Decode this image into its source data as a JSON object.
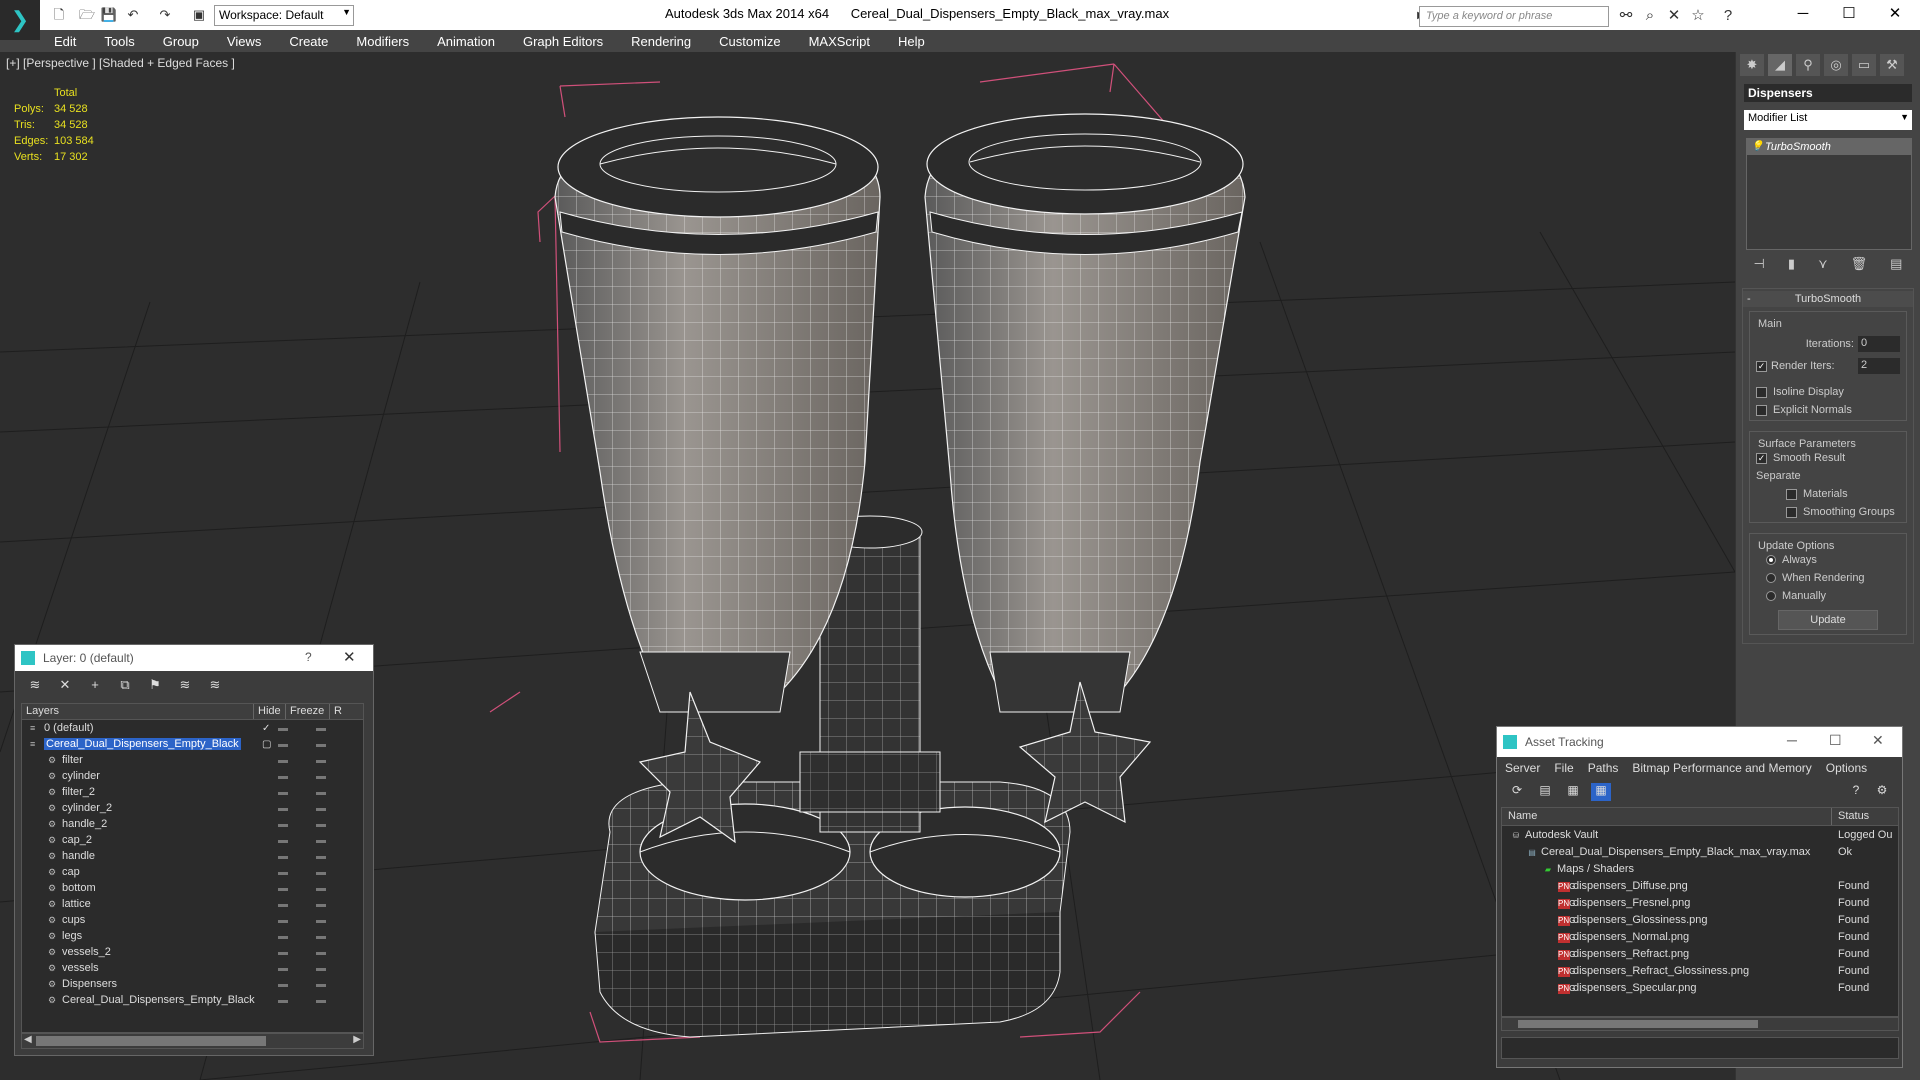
{
  "titlebar": {
    "workspace": "Workspace: Default",
    "app_name": "Autodesk 3ds Max  2014 x64",
    "file_name": "Cereal_Dual_Dispensers_Empty_Black_max_vray.max",
    "search_placeholder": "Type a keyword or phrase"
  },
  "menu": [
    "Edit",
    "Tools",
    "Group",
    "Views",
    "Create",
    "Modifiers",
    "Animation",
    "Graph Editors",
    "Rendering",
    "Customize",
    "MAXScript",
    "Help"
  ],
  "viewport": {
    "label": "[+] [Perspective ] [Shaded + Edged Faces ]",
    "stats": {
      "header": "Total",
      "polys_label": "Polys:",
      "polys": "34 528",
      "tris_label": "Tris:",
      "tris": "34 528",
      "edges_label": "Edges:",
      "edges": "103 584",
      "verts_label": "Verts:",
      "verts": "17 302"
    }
  },
  "command_panel": {
    "object_name": "Dispensers",
    "modifier_list": "Modifier List",
    "stack": [
      "TurboSmooth"
    ],
    "rollout_title": "TurboSmooth",
    "main_group": "Main",
    "iterations_label": "Iterations:",
    "iterations": "0",
    "render_iters_label": "Render Iters:",
    "render_iters": "2",
    "isoline": "Isoline Display",
    "explicit_normals": "Explicit Normals",
    "surface_group": "Surface Parameters",
    "smooth_result": "Smooth Result",
    "separate": "Separate",
    "materials": "Materials",
    "smoothing_groups": "Smoothing Groups",
    "update_group": "Update Options",
    "always": "Always",
    "when_rendering": "When Rendering",
    "manually": "Manually",
    "update_button": "Update"
  },
  "layer_explorer": {
    "title": "Layer: 0 (default)",
    "help": "?",
    "columns": [
      "Layers",
      "Hide",
      "Freeze",
      "R"
    ],
    "rows": [
      {
        "name": "0 (default)",
        "level": 1,
        "checked": true
      },
      {
        "name": "Cereal_Dual_Dispensers_Empty_Black",
        "level": 1,
        "selected": true
      },
      {
        "name": "filter",
        "level": 2
      },
      {
        "name": "cylinder",
        "level": 2
      },
      {
        "name": "filter_2",
        "level": 2
      },
      {
        "name": "cylinder_2",
        "level": 2
      },
      {
        "name": "handle_2",
        "level": 2
      },
      {
        "name": "cap_2",
        "level": 2
      },
      {
        "name": "handle",
        "level": 2
      },
      {
        "name": "cap",
        "level": 2
      },
      {
        "name": "bottom",
        "level": 2
      },
      {
        "name": "lattice",
        "level": 2
      },
      {
        "name": "cups",
        "level": 2
      },
      {
        "name": "legs",
        "level": 2
      },
      {
        "name": "vessels_2",
        "level": 2
      },
      {
        "name": "vessels",
        "level": 2
      },
      {
        "name": "Dispensers",
        "level": 2
      },
      {
        "name": "Cereal_Dual_Dispensers_Empty_Black",
        "level": 2
      }
    ]
  },
  "asset_tracking": {
    "title": "Asset Tracking",
    "menu": [
      "Server",
      "File",
      "Paths",
      "Bitmap Performance and Memory",
      "Options"
    ],
    "columns": [
      "Name",
      "Status"
    ],
    "rows": [
      {
        "name": "Autodesk Vault",
        "status": "Logged Ou",
        "level": 1,
        "icon": "vault"
      },
      {
        "name": "Cereal_Dual_Dispensers_Empty_Black_max_vray.max",
        "status": "Ok",
        "level": 2,
        "icon": "file"
      },
      {
        "name": "Maps / Shaders",
        "status": "",
        "level": 3,
        "icon": "folder"
      },
      {
        "name": "dispensers_Diffuse.png",
        "status": "Found",
        "level": 4,
        "icon": "png"
      },
      {
        "name": "dispensers_Fresnel.png",
        "status": "Found",
        "level": 4,
        "icon": "png"
      },
      {
        "name": "dispensers_Glossiness.png",
        "status": "Found",
        "level": 4,
        "icon": "png"
      },
      {
        "name": "dispensers_Normal.png",
        "status": "Found",
        "level": 4,
        "icon": "png"
      },
      {
        "name": "dispensers_Refract.png",
        "status": "Found",
        "level": 4,
        "icon": "png"
      },
      {
        "name": "dispensers_Refract_Glossiness.png",
        "status": "Found",
        "level": 4,
        "icon": "png"
      },
      {
        "name": "dispensers_Specular.png",
        "status": "Found",
        "level": 4,
        "icon": "png"
      }
    ]
  },
  "colors": {
    "stats_text": "#e8e020",
    "selection": "#2c64c8",
    "bbox": "#d0507a"
  }
}
